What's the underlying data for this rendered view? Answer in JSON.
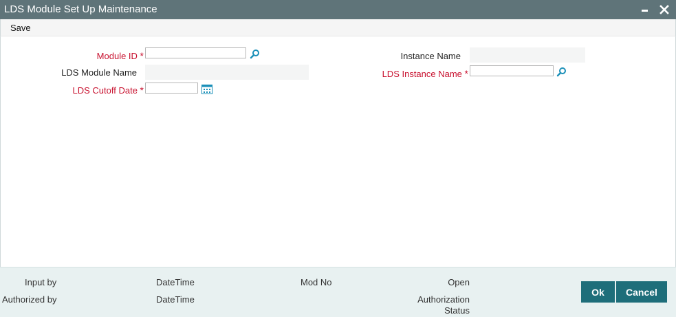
{
  "window": {
    "title": "LDS Module Set Up Maintenance"
  },
  "toolbar": {
    "save_label": "Save"
  },
  "form": {
    "module_id": {
      "label": "Module ID",
      "required_mark": "*",
      "value": ""
    },
    "module_name": {
      "label": "LDS Module Name",
      "value": ""
    },
    "cutoff_date": {
      "label": "LDS Cutoff Date",
      "required_mark": "*",
      "value": ""
    },
    "instance_name": {
      "label": "Instance Name",
      "value": ""
    },
    "lds_instance_name": {
      "label": "LDS Instance Name",
      "required_mark": "*",
      "value": ""
    }
  },
  "footer": {
    "input_by": "Input by",
    "datetime1": "DateTime",
    "mod_no": "Mod No",
    "open": "Open",
    "authorized_by": "Authorized by",
    "datetime2": "DateTime",
    "auth_status_line1": "Authorization",
    "auth_status_line2": "Status",
    "ok_label": "Ok",
    "cancel_label": "Cancel"
  },
  "colors": {
    "title_bar": "#5f7479",
    "required": "#c8102e",
    "button": "#1e6e7a",
    "footer_bg": "#e8f1f1",
    "icon": "#1a8fb8"
  },
  "icons": {
    "lookup": "magnifier-icon",
    "calendar": "calendar-icon",
    "minimize": "minimize-icon",
    "close": "close-icon"
  }
}
